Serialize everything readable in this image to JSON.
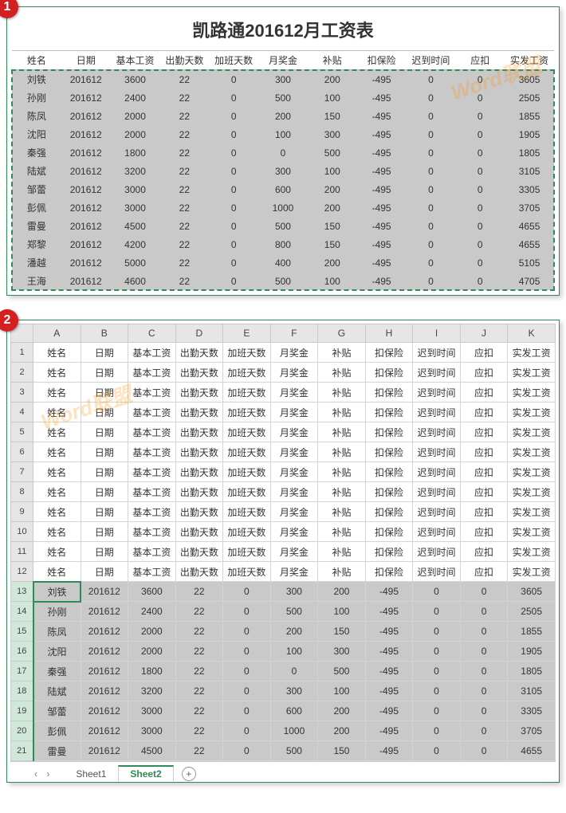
{
  "panel1": {
    "badge": "1",
    "title": "凯路通201612月工资表",
    "headers": [
      "姓名",
      "日期",
      "基本工资",
      "出勤天数",
      "加班天数",
      "月奖金",
      "补贴",
      "扣保险",
      "迟到时间",
      "应扣",
      "实发工资"
    ],
    "rows": [
      [
        "刘铁",
        "201612",
        "3600",
        "22",
        "0",
        "300",
        "200",
        "-495",
        "0",
        "0",
        "3605"
      ],
      [
        "孙刚",
        "201612",
        "2400",
        "22",
        "0",
        "500",
        "100",
        "-495",
        "0",
        "0",
        "2505"
      ],
      [
        "陈凤",
        "201612",
        "2000",
        "22",
        "0",
        "200",
        "150",
        "-495",
        "0",
        "0",
        "1855"
      ],
      [
        "沈阳",
        "201612",
        "2000",
        "22",
        "0",
        "100",
        "300",
        "-495",
        "0",
        "0",
        "1905"
      ],
      [
        "秦强",
        "201612",
        "1800",
        "22",
        "0",
        "0",
        "500",
        "-495",
        "0",
        "0",
        "1805"
      ],
      [
        "陆斌",
        "201612",
        "3200",
        "22",
        "0",
        "300",
        "100",
        "-495",
        "0",
        "0",
        "3105"
      ],
      [
        "邹蕾",
        "201612",
        "3000",
        "22",
        "0",
        "600",
        "200",
        "-495",
        "0",
        "0",
        "3305"
      ],
      [
        "彭佩",
        "201612",
        "3000",
        "22",
        "0",
        "1000",
        "200",
        "-495",
        "0",
        "0",
        "3705"
      ],
      [
        "雷曼",
        "201612",
        "4500",
        "22",
        "0",
        "500",
        "150",
        "-495",
        "0",
        "0",
        "4655"
      ],
      [
        "郑黎",
        "201612",
        "4200",
        "22",
        "0",
        "800",
        "150",
        "-495",
        "0",
        "0",
        "4655"
      ],
      [
        "潘越",
        "201612",
        "5000",
        "22",
        "0",
        "400",
        "200",
        "-495",
        "0",
        "0",
        "5105"
      ],
      [
        "王海",
        "201612",
        "4600",
        "22",
        "0",
        "500",
        "100",
        "-495",
        "0",
        "0",
        "4705"
      ]
    ],
    "watermark": "Word联盟"
  },
  "panel2": {
    "badge": "2",
    "columns": [
      "A",
      "B",
      "C",
      "D",
      "E",
      "F",
      "G",
      "H",
      "I",
      "J",
      "K"
    ],
    "header_row_values": [
      "姓名",
      "日期",
      "基本工资",
      "出勤天数",
      "加班天数",
      "月奖金",
      "补贴",
      "扣保险",
      "迟到时间",
      "应扣",
      "实发工资"
    ],
    "header_repeat_count": 12,
    "data_start_row": 13,
    "data_rows": [
      [
        "刘铁",
        "201612",
        "3600",
        "22",
        "0",
        "300",
        "200",
        "-495",
        "0",
        "0",
        "3605"
      ],
      [
        "孙刚",
        "201612",
        "2400",
        "22",
        "0",
        "500",
        "100",
        "-495",
        "0",
        "0",
        "2505"
      ],
      [
        "陈凤",
        "201612",
        "2000",
        "22",
        "0",
        "200",
        "150",
        "-495",
        "0",
        "0",
        "1855"
      ],
      [
        "沈阳",
        "201612",
        "2000",
        "22",
        "0",
        "100",
        "300",
        "-495",
        "0",
        "0",
        "1905"
      ],
      [
        "秦强",
        "201612",
        "1800",
        "22",
        "0",
        "0",
        "500",
        "-495",
        "0",
        "0",
        "1805"
      ],
      [
        "陆斌",
        "201612",
        "3200",
        "22",
        "0",
        "300",
        "100",
        "-495",
        "0",
        "0",
        "3105"
      ],
      [
        "邹蕾",
        "201612",
        "3000",
        "22",
        "0",
        "600",
        "200",
        "-495",
        "0",
        "0",
        "3305"
      ],
      [
        "彭佩",
        "201612",
        "3000",
        "22",
        "0",
        "1000",
        "200",
        "-495",
        "0",
        "0",
        "3705"
      ],
      [
        "雷曼",
        "201612",
        "4500",
        "22",
        "0",
        "500",
        "150",
        "-495",
        "0",
        "0",
        "4655"
      ]
    ],
    "tabs": {
      "nav": "‹ ›",
      "sheet1": "Sheet1",
      "sheet2": "Sheet2"
    },
    "watermark": "Word联盟"
  }
}
